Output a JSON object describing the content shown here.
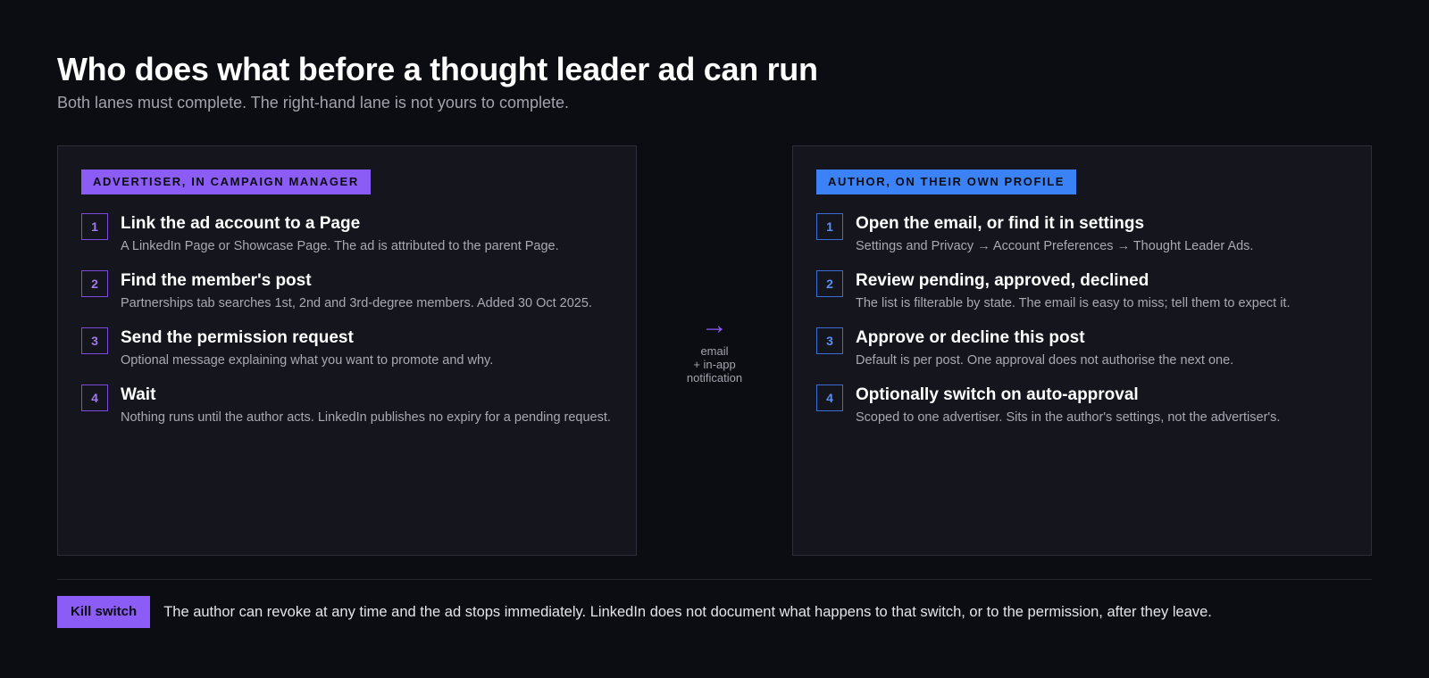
{
  "header": {
    "title": "Who does what before a thought leader ad can run",
    "subtitle": "Both lanes must complete. The right-hand lane is not yours to complete."
  },
  "lanes": [
    {
      "tag": "ADVERTISER, IN CAMPAIGN MANAGER",
      "accent": "#8b5cf6",
      "steps": [
        {
          "num": "1",
          "title": "Link the ad account to a Page",
          "desc": "A LinkedIn Page or Showcase Page. The ad is attributed to the parent Page."
        },
        {
          "num": "2",
          "title": "Find the member's post",
          "desc": "Partnerships tab searches 1st, 2nd and 3rd-degree members. Added 30 Oct 2025."
        },
        {
          "num": "3",
          "title": "Send the permission request",
          "desc": "Optional message explaining what you want to promote and why."
        },
        {
          "num": "4",
          "title": "Wait",
          "desc": "Nothing runs until the author acts. LinkedIn publishes no expiry for a pending request."
        }
      ]
    },
    {
      "tag": "AUTHOR, ON THEIR OWN PROFILE",
      "accent": "#3b82f6",
      "steps": [
        {
          "num": "1",
          "title": "Open the email, or find it in settings",
          "desc": "Settings and Privacy → Account Preferences → Thought Leader Ads."
        },
        {
          "num": "2",
          "title": "Review pending, approved, declined",
          "desc": "The list is filterable by state. The email is easy to miss; tell them to expect it."
        },
        {
          "num": "3",
          "title": "Approve or decline this post",
          "desc": "Default is per post. One approval does not authorise the next one."
        },
        {
          "num": "4",
          "title": "Optionally switch on auto-approval",
          "desc": "Scoped to one advertiser. Sits in the author's settings, not the advertiser's."
        }
      ]
    }
  ],
  "connector": {
    "arrow": "→",
    "line1": "email",
    "line2": "+ in-app",
    "line3": "notification"
  },
  "footer": {
    "tag": "Kill switch",
    "text": "The author can revoke at any time and the ad stops immediately. LinkedIn does not document what happens to that switch, or to the permission, after they leave."
  }
}
